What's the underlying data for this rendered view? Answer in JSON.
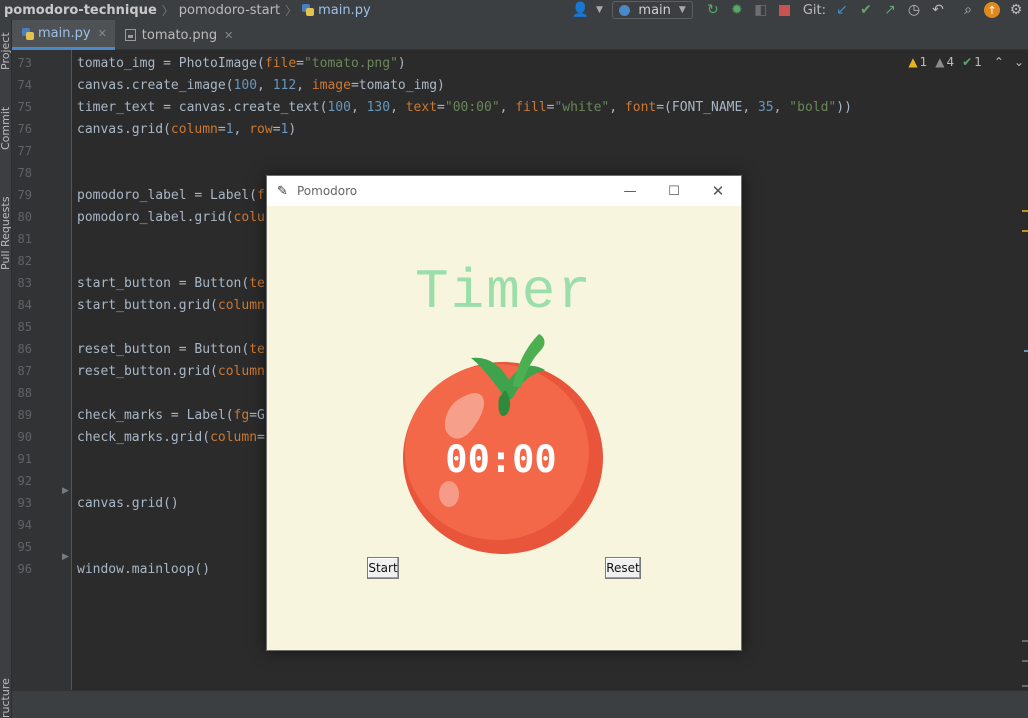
{
  "breadcrumb": {
    "project": "pomodoro-technique",
    "folder": "pomodoro-start",
    "file": "main.py"
  },
  "toolbar": {
    "branch": "main",
    "git_label": "Git:"
  },
  "tabs": [
    {
      "label": "main.py",
      "active": true
    },
    {
      "label": "tomato.png",
      "active": false
    }
  ],
  "tool_stripe": {
    "project": "Project",
    "commit": "Commit",
    "pull_requests": "Pull Requests",
    "structure": "ructure"
  },
  "inspections": {
    "warnings": "1",
    "weak_warnings": "4",
    "typos": "1"
  },
  "line_numbers": [
    "73",
    "74",
    "75",
    "76",
    "77",
    "78",
    "79",
    "80",
    "81",
    "82",
    "83",
    "84",
    "85",
    "86",
    "87",
    "88",
    "89",
    "90",
    "91",
    "92",
    "93",
    "94",
    "95",
    "96"
  ],
  "code_lines": [
    [
      [
        "tomato_img = PhotoImage(",
        "t-plain"
      ],
      [
        "file",
        "t-kw"
      ],
      [
        "=",
        "t-plain"
      ],
      [
        "\"tomato.png\"",
        "t-str"
      ],
      [
        ")",
        "t-plain"
      ]
    ],
    [
      [
        "canvas.create_image(",
        "t-plain"
      ],
      [
        "100",
        "t-num"
      ],
      [
        ", ",
        "t-plain"
      ],
      [
        "112",
        "t-num"
      ],
      [
        ", ",
        "t-plain"
      ],
      [
        "image",
        "t-kw"
      ],
      [
        "=tomato_img)",
        "t-plain"
      ]
    ],
    [
      [
        "timer_text = canvas.create_text(",
        "t-plain"
      ],
      [
        "100",
        "t-num"
      ],
      [
        ", ",
        "t-plain"
      ],
      [
        "130",
        "t-num"
      ],
      [
        ", ",
        "t-plain"
      ],
      [
        "text",
        "t-kw"
      ],
      [
        "=",
        "t-plain"
      ],
      [
        "\"00:00\"",
        "t-str"
      ],
      [
        ", ",
        "t-plain"
      ],
      [
        "fill",
        "t-kw"
      ],
      [
        "=",
        "t-plain"
      ],
      [
        "\"white\"",
        "t-str"
      ],
      [
        ", ",
        "t-plain"
      ],
      [
        "font",
        "t-kw"
      ],
      [
        "=(FONT_NAME, ",
        "t-plain"
      ],
      [
        "35",
        "t-num"
      ],
      [
        ", ",
        "t-plain"
      ],
      [
        "\"bold\"",
        "t-str"
      ],
      [
        "))",
        "t-plain"
      ]
    ],
    [
      [
        "canvas.grid(",
        "t-plain"
      ],
      [
        "column",
        "t-kw"
      ],
      [
        "=",
        "t-plain"
      ],
      [
        "1",
        "t-num"
      ],
      [
        ", ",
        "t-plain"
      ],
      [
        "row",
        "t-kw"
      ],
      [
        "=",
        "t-plain"
      ],
      [
        "1",
        "t-num"
      ],
      [
        ")",
        "t-plain"
      ]
    ],
    [],
    [],
    [
      [
        "pomodoro_label = Label(",
        "t-plain"
      ],
      [
        "f",
        "t-kw"
      ]
    ],
    [
      [
        "pomodoro_label.grid(",
        "t-plain"
      ],
      [
        "colu",
        "t-kw"
      ]
    ],
    [],
    [],
    [
      [
        "start_button = Button(",
        "t-plain"
      ],
      [
        "te",
        "t-kw"
      ]
    ],
    [
      [
        "start_button.grid(",
        "t-plain"
      ],
      [
        "column",
        "t-kw"
      ]
    ],
    [],
    [
      [
        "reset_button = Button(",
        "t-plain"
      ],
      [
        "te",
        "t-kw"
      ]
    ],
    [
      [
        "reset_button.grid(",
        "t-plain"
      ],
      [
        "column",
        "t-kw"
      ]
    ],
    [],
    [
      [
        "check_marks = Label(",
        "t-plain"
      ],
      [
        "fg",
        "t-kw"
      ],
      [
        "=G",
        "t-plain"
      ]
    ],
    [
      [
        "check_marks.grid(",
        "t-plain"
      ],
      [
        "column",
        "t-kw"
      ],
      [
        "=",
        "t-plain"
      ]
    ],
    [],
    [],
    [
      [
        "canvas.grid()",
        "t-plain"
      ]
    ],
    [],
    [],
    [
      [
        "window.mainloop()",
        "t-plain"
      ]
    ]
  ],
  "app_window": {
    "title": "Pomodoro",
    "heading": "Timer",
    "timer_text": "00:00",
    "start_label": "Start",
    "reset_label": "Reset",
    "check_marks": "",
    "colors": {
      "background": "#f7f5dd",
      "heading": "#9bdeac",
      "tomato": "#f26849",
      "leaf": "#3fa34d"
    }
  }
}
